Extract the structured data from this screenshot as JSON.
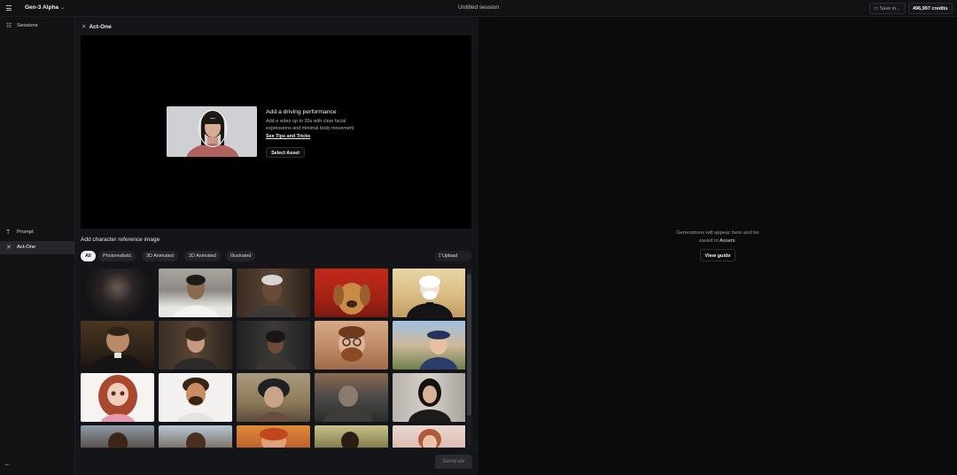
{
  "topbar": {
    "model_label": "Gen-3 Alpha",
    "session_title": "Untitled session",
    "save_label": "Save in...",
    "credits_label": "496,997 credits"
  },
  "sidebar": {
    "items": [
      {
        "label": "Sessions",
        "icon": "sessions-icon"
      },
      {
        "label": "Prompt",
        "icon": "text-icon"
      },
      {
        "label": "Act-One",
        "icon": "act-one-icon"
      }
    ]
  },
  "panel": {
    "title": "Act-One",
    "driving": {
      "title": "Add a driving performance",
      "description": "Add a video up to 30s with clear facial expressions and minimal body movement.",
      "tips_link": "See Tips and Tricks",
      "select_button": "Select Asset"
    },
    "character": {
      "heading": "Add character reference image",
      "filters": [
        "All",
        "Photorealistic",
        "3D Animated",
        "2D Animated",
        "Illustrated"
      ],
      "active_filter": "All",
      "upload_label": "Upload"
    },
    "generate_label": "Generate"
  },
  "output": {
    "empty_text_line1": "Generations will appear here and be",
    "empty_text_line2_prefix": "saved to ",
    "assets_link": "Assets",
    "empty_text_suffix": ".",
    "view_guide_label": "View guide"
  },
  "colors": {
    "background": "#0b0b0c",
    "panel": "#141518",
    "accent_chip": "#f1f1f3"
  }
}
